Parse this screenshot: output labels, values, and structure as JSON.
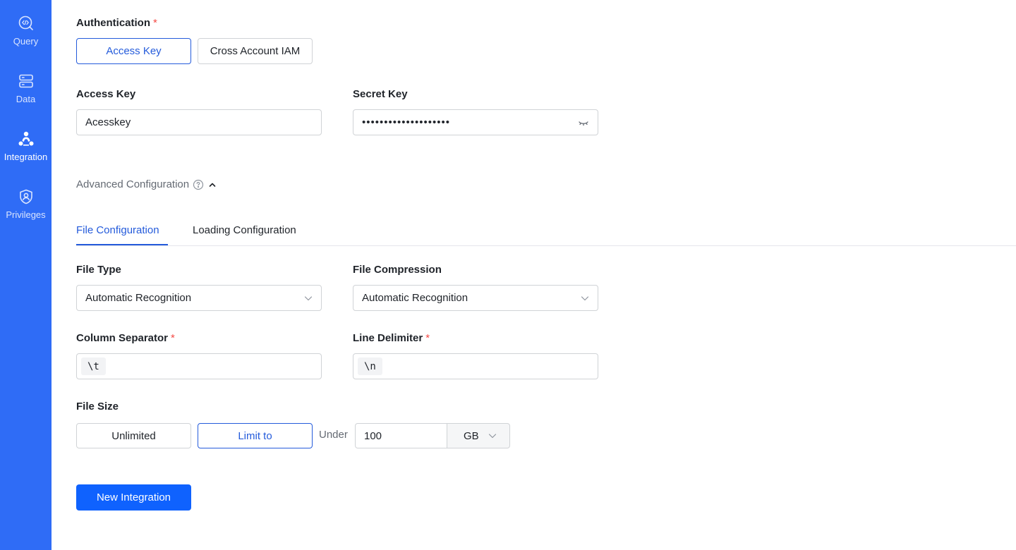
{
  "sidebar": {
    "items": [
      {
        "label": "Query",
        "icon": "query-icon"
      },
      {
        "label": "Data",
        "icon": "database-icon"
      },
      {
        "label": "Integration",
        "icon": "integration-icon"
      },
      {
        "label": "Privileges",
        "icon": "shield-user-icon"
      }
    ],
    "active": "Integration",
    "background": "#2f6cf6"
  },
  "form": {
    "authentication": {
      "label": "Authentication",
      "required_mark": "*",
      "options": [
        "Access Key",
        "Cross Account IAM"
      ],
      "selected": "Access Key"
    },
    "access_key": {
      "label": "Access Key",
      "value": "Acesskey"
    },
    "secret_key": {
      "label": "Secret Key",
      "value": "••••••••••••••••••••",
      "toggle_icon": "eye-closed-icon"
    },
    "advanced": {
      "label": "Advanced Configuration",
      "help_icon": "question-circle-icon",
      "toggle_icon": "chevron-up-icon"
    },
    "tabs": [
      {
        "label": "File Configuration",
        "active": true
      },
      {
        "label": "Loading Configuration",
        "active": false
      }
    ],
    "file_type": {
      "label": "File Type",
      "value": "Automatic Recognition"
    },
    "file_compression": {
      "label": "File Compression",
      "value": "Automatic Recognition"
    },
    "column_separator": {
      "label": "Column Separator",
      "required_mark": "*",
      "value": "\\t"
    },
    "line_delimiter": {
      "label": "Line Delimiter",
      "required_mark": "*",
      "value": "\\n"
    },
    "file_size": {
      "label": "File Size",
      "options": [
        "Unlimited",
        "Limit to"
      ],
      "selected": "Limit to",
      "under_label": "Under",
      "amount": "100",
      "unit": "GB"
    },
    "submit_label": "New Integration"
  },
  "colors": {
    "primary": "#0f62fe",
    "selected_border": "#245bdb",
    "required": "#f54a45"
  }
}
